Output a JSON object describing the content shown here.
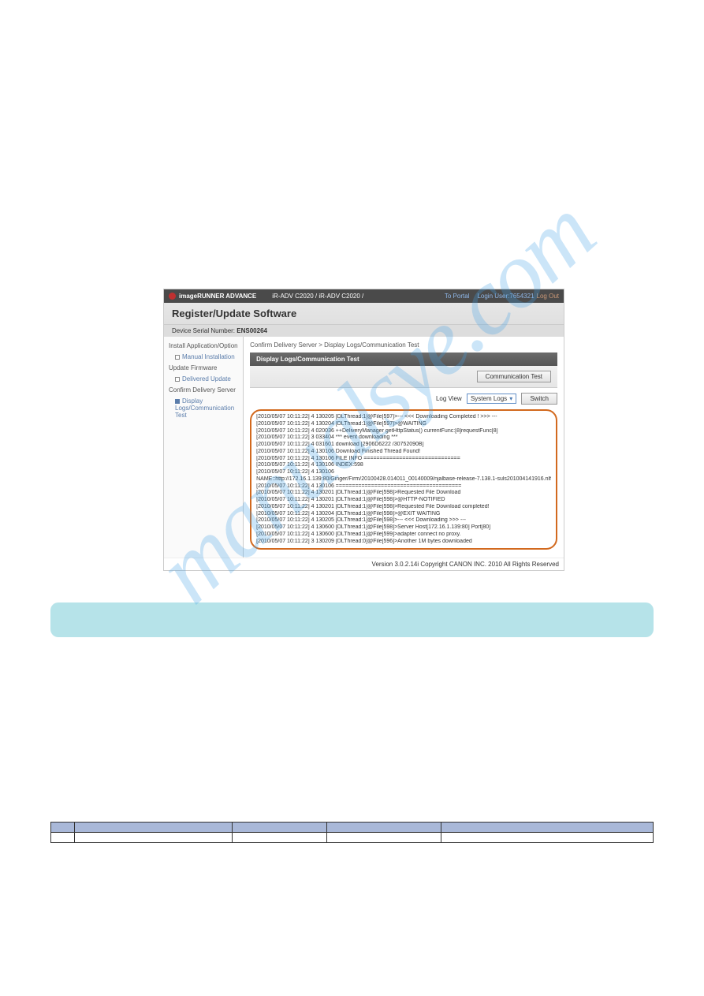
{
  "watermark": "manualsye.com",
  "app": {
    "brand": "imageRUNNER ADVANCE",
    "model": "iR-ADV C2020 / iR-ADV C2020 /",
    "portal": "To Portal",
    "login_label": "Login User:",
    "login_user": "7654321",
    "logout": "Log Out",
    "page_title": "Register/Update Software",
    "serial_label": "Device Serial Number:",
    "serial_value": "ENS00264",
    "sidebar": {
      "s1": "Install Application/Option",
      "s1a": "Manual Installation",
      "s2": "Update Firmware",
      "s2a": "Delivered Update",
      "s3": "Confirm Delivery Server",
      "s3a": "Display Logs/Communication Test"
    },
    "breadcrumb": "Confirm Delivery Server > Display Logs/Communication Test",
    "panel_title": "Display Logs/Communication Test",
    "comm_test_btn": "Communication Test",
    "logview_label": "Log View",
    "logview_select": "System Logs",
    "switch_btn": "Switch",
    "logs": [
      "[2010/05/07 10:11:22] 4 130205 [DLThread:1]@File[597]>--- <<< Downloading Completed ! >>> ---",
      "[2010/05/07 10:11:22] 4 130204 [DLThread:1]@File[597]>@WAITING",
      "[2010/05/07 10:11:22] 4 020036 ++DeliveryManager getHttpStatus() currentFunc:[8]requestFunc[8]",
      "[2010/05/07 10:11:22] 3 033404 *** event downloading ***",
      "[2010/05/07 10:11:22] 4 031601 download [2906D6222 /30752090B]",
      "[2010/05/07 10:11:22] 4 130106 Download Finished Thread Found!",
      "[2010/05/07 10:11:22] 4 130106 FILE INFO ==============================",
      "[2010/05/07 10:11:22] 4 130106 INDEX:598",
      "[2010/05/07 10:11:22] 4 130106",
      "NAME::http://172.16.1.139:80/Ginger/Firm/20100428.014011_00140009/njalbase-release-7.138.1-suls201004141916.nlf",
      "[2010/05/07 10:11:22] 4 130106 =======================================",
      "[2010/05/07 10:11:22] 4 130201 [DLThread:1]@File[598]>Requested File Download",
      "[2010/05/07 10:11:22] 4 130201 [DLThread:1]@File[598]>@HTTP-NOTIFIED",
      "[2010/05/07 10:11:22] 4 130201 [DLThread:1]@File[598]>Requested File Download completed!",
      "[2010/05/07 10:11:22] 4 130204 [DLThread:1]@File[598]>@EXIT WAITING",
      "[2010/05/07 10:11:22] 4 130205 [DLThread:1]@File[598]>--- <<< Downloading >>> ---",
      "[2010/05/07 10:11:22] 4 130600 [DLThread:1]@File[598]>Server Host[172.16.1.139:80] Port[80]",
      "[2010/05/07 10:11:22] 4 130600 [DLThread:1]@File[599]>adapter connect no proxy.",
      "[2010/05/07 10:11:22] 3 130209 [DLThread:0]@File[596]>Another 1M bytes downloaded"
    ],
    "version": "Version 3.0.2.14i Copyright CANON INC. 2010 All Rights Reserved"
  },
  "note": "",
  "table": {
    "h1": "",
    "h2": "",
    "h3": "",
    "h4": "",
    "h5": "",
    "r1c1": "",
    "r1c2": "",
    "r1c3": "",
    "r1c4": "",
    "r1c5": ""
  }
}
